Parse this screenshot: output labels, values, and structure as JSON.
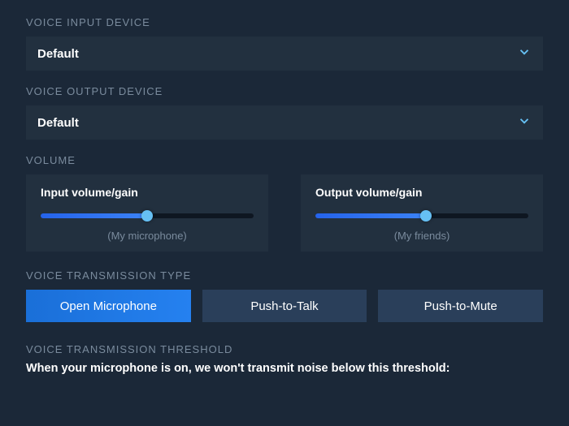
{
  "input_device": {
    "label": "VOICE INPUT DEVICE",
    "value": "Default"
  },
  "output_device": {
    "label": "VOICE OUTPUT DEVICE",
    "value": "Default"
  },
  "volume": {
    "label": "VOLUME",
    "input": {
      "title": "Input volume/gain",
      "caption": "(My microphone)",
      "percent": 50
    },
    "output": {
      "title": "Output volume/gain",
      "caption": "(My friends)",
      "percent": 52
    }
  },
  "transmission": {
    "label": "VOICE TRANSMISSION TYPE",
    "options": {
      "open": "Open Microphone",
      "ptt": "Push-to-Talk",
      "ptm": "Push-to-Mute"
    },
    "selected": "open"
  },
  "threshold": {
    "label": "VOICE TRANSMISSION THRESHOLD",
    "description": "When your microphone is on, we won't transmit noise below this threshold:"
  }
}
